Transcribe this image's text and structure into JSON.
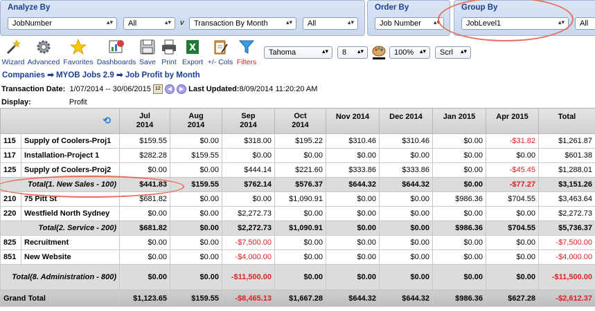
{
  "analyze": {
    "title": "Analyze By",
    "field1": "JobNumber",
    "field1_filter": "All",
    "separator": "v",
    "field2": "Transaction By Month",
    "field2_filter": "All"
  },
  "order": {
    "title": "Order By",
    "value": "Job Number"
  },
  "group": {
    "title": "Group By",
    "value": "JobLevel1",
    "filter": "All"
  },
  "toolbar": {
    "wizard": "Wizard",
    "advanced": "Advanced",
    "favorites": "Favorites",
    "dashboards": "Dashboards",
    "save": "Save",
    "print": "Print",
    "export": "Export",
    "cols": "+/- Cols",
    "filters": "Filters",
    "font": "Tahoma",
    "font_size": "8",
    "zoom": "100%",
    "scroll": "Scrl"
  },
  "breadcrumb": {
    "item1": "Companies",
    "item2": "MYOB Jobs 2.9",
    "item3": "Job Profit by Month",
    "sep": "➡"
  },
  "meta": {
    "date_label": "Transaction Date:",
    "date_value": "1/07/2014 -- 30/06/2015",
    "updated_label": "Last Updated:",
    "updated_value": "8/09/2014 11:20:20 AM",
    "display_label": "Display:",
    "display_value": "Profit"
  },
  "table": {
    "headers": [
      {
        "l1": "Jul",
        "l2": "2014"
      },
      {
        "l1": "Aug",
        "l2": "2014"
      },
      {
        "l1": "Sep",
        "l2": "2014"
      },
      {
        "l1": "Oct",
        "l2": "2014"
      },
      {
        "l1": "Nov 2014",
        "l2": ""
      },
      {
        "l1": "Dec 2014",
        "l2": ""
      },
      {
        "l1": "Jan 2015",
        "l2": ""
      },
      {
        "l1": "Apr 2015",
        "l2": ""
      },
      {
        "l1": "Total",
        "l2": ""
      }
    ],
    "rows": [
      {
        "type": "job",
        "code": "115",
        "name": "Supply of Coolers-Proj1",
        "values": [
          "$159.55",
          "$0.00",
          "$318.00",
          "$195.22",
          "$310.46",
          "$310.46",
          "$0.00",
          "-$31.82",
          "$1,261.87"
        ]
      },
      {
        "type": "job",
        "code": "117",
        "name": "Installation-Project 1",
        "values": [
          "$282.28",
          "$159.55",
          "$0.00",
          "$0.00",
          "$0.00",
          "$0.00",
          "$0.00",
          "$0.00",
          "$601.38"
        ]
      },
      {
        "type": "job",
        "code": "125",
        "name": "Supply of Coolers-Proj2",
        "values": [
          "$0.00",
          "$0.00",
          "$444.14",
          "$221.60",
          "$333.86",
          "$333.86",
          "$0.00",
          "-$45.45",
          "$1,288.01"
        ]
      },
      {
        "type": "total",
        "label": "Total(1. New Sales - 100)",
        "values": [
          "$441.83",
          "$159.55",
          "$762.14",
          "$576.37",
          "$644.32",
          "$644.32",
          "$0.00",
          "-$77.27",
          "$3,151.26"
        ]
      },
      {
        "type": "job",
        "code": "210",
        "name": "75 Pitt St",
        "values": [
          "$681.82",
          "$0.00",
          "$0.00",
          "$1,090.91",
          "$0.00",
          "$0.00",
          "$986.36",
          "$704.55",
          "$3,463.64"
        ]
      },
      {
        "type": "job",
        "code": "220",
        "name": "Westfield North Sydney",
        "values": [
          "$0.00",
          "$0.00",
          "$2,272.73",
          "$0.00",
          "$0.00",
          "$0.00",
          "$0.00",
          "$0.00",
          "$2,272.73"
        ]
      },
      {
        "type": "total",
        "label": "Total(2. Service - 200)",
        "values": [
          "$681.82",
          "$0.00",
          "$2,272.73",
          "$1,090.91",
          "$0.00",
          "$0.00",
          "$986.36",
          "$704.55",
          "$5,736.37"
        ]
      },
      {
        "type": "job",
        "code": "825",
        "name": "Recruitment",
        "values": [
          "$0.00",
          "$0.00",
          "-$7,500.00",
          "$0.00",
          "$0.00",
          "$0.00",
          "$0.00",
          "$0.00",
          "-$7,500.00"
        ]
      },
      {
        "type": "job",
        "code": "851",
        "name": "New Website",
        "values": [
          "$0.00",
          "$0.00",
          "-$4,000.00",
          "$0.00",
          "$0.00",
          "$0.00",
          "$0.00",
          "$0.00",
          "-$4,000.00"
        ]
      },
      {
        "type": "total3",
        "label": "Total(8. Administration - 800)",
        "values": [
          "$0.00",
          "$0.00",
          "-$11,500.00",
          "$0.00",
          "$0.00",
          "$0.00",
          "$0.00",
          "$0.00",
          "-$11,500.00"
        ]
      },
      {
        "type": "grand",
        "label": "Grand Total",
        "values": [
          "$1,123.65",
          "$159.55",
          "-$8,465.13",
          "$1,667.28",
          "$644.32",
          "$644.32",
          "$986.36",
          "$627.28",
          "-$2,612.37"
        ]
      }
    ]
  },
  "colors": {
    "accent": "#1b3f8f",
    "negative": "#e02020",
    "annotation": "#e8705a"
  }
}
